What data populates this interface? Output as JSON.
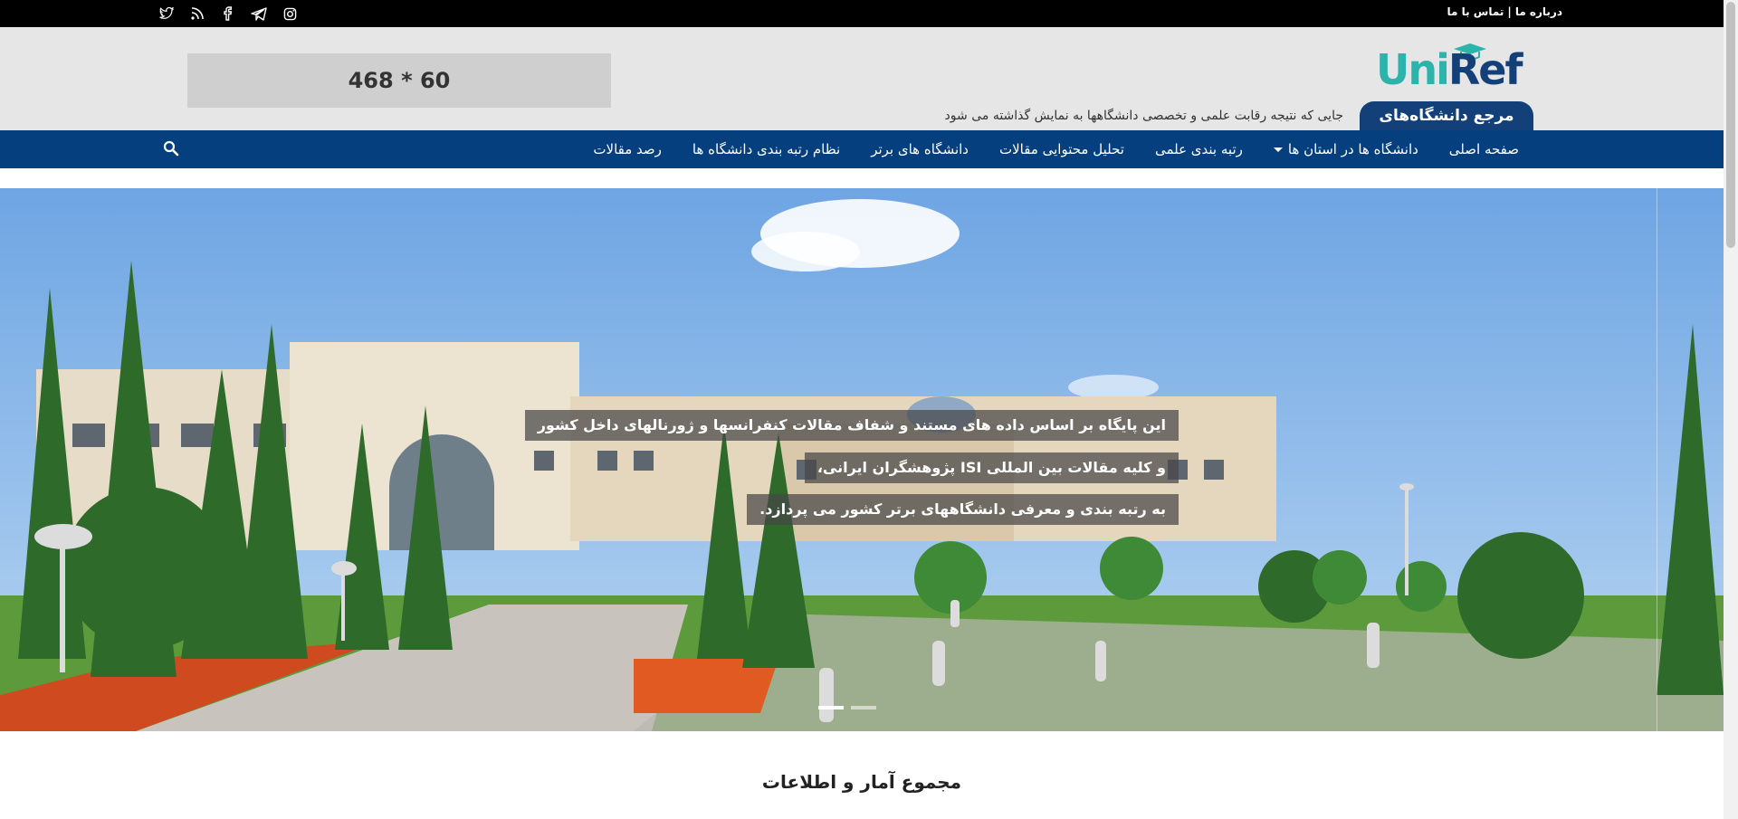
{
  "topbar": {
    "links": [
      "درباره ما",
      "تماس با ما"
    ],
    "separator": "|",
    "socials": [
      "twitter-icon",
      "rss-icon",
      "facebook-icon",
      "telegram-icon",
      "instagram-icon"
    ]
  },
  "header": {
    "logo_word": "UniRef",
    "logo_tagline": "مرجع دانشگاه‌های ایران",
    "slogan": "جایی که نتیجه رقابت علمی و تخصصی دانشگاهها به نمایش گذاشته می شود",
    "ad_text": "468 * 60"
  },
  "nav": {
    "items": [
      "صفحه اصلی",
      "دانشگاه ها در استان ها",
      "رتبه بندی علمی",
      "تحلیل محتوایی مقالات",
      "دانشگاه های برتر",
      "نظام رتبه بندی دانشگاه ها",
      "رصد مقالات"
    ],
    "search_icon": "search-icon"
  },
  "hero": {
    "captions": [
      "این پایگاه بر اساس داده های مستند و شفاف مقالات کنفرانسها و ژورنالهای داخل کشور",
      "و کلیه مقالات بین المللی ISI پژوهشگران ایرانی،",
      "به رتبه بندی و معرفی دانشگاههای برتر کشور می پردازد."
    ]
  },
  "stats": {
    "title": "مجموع آمار و اطلاعات"
  },
  "colors": {
    "nav_bg": "#053f7d",
    "brand_teal": "#2bb3ac",
    "brand_blue": "#14407a"
  }
}
